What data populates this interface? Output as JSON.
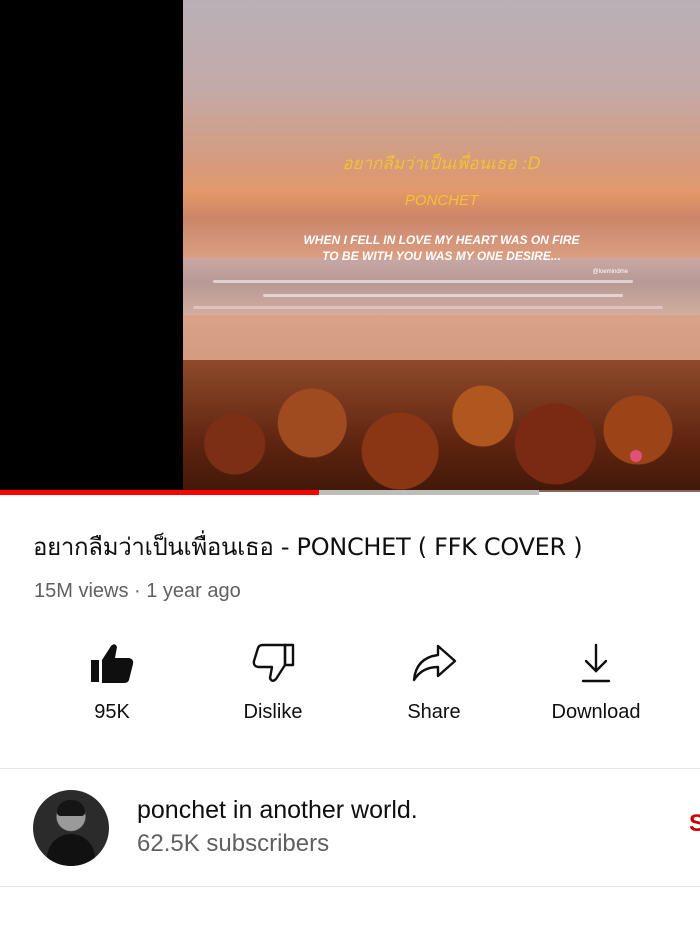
{
  "player": {
    "overlay_title": "อยากลืมว่าเป็นเพื่อนเธอ :D",
    "overlay_artist": "PONCHET",
    "overlay_lyrics_line1": "WHEN I FELL IN LOVE MY HEART WAS ON FIRE",
    "overlay_lyrics_line2": "TO BE WITH YOU WAS MY ONE DESIRE...",
    "overlay_credit": "@loemindme",
    "progress_fraction": 0.455,
    "buffered_fraction": 0.77,
    "progress_color": "#ff0000"
  },
  "video": {
    "title": "อยากลืมว่าเป็นเพื่อนเธอ - PONCHET ( FFK COVER )",
    "meta": "15M views · 1 year ago"
  },
  "actions": [
    {
      "icon": "thumbs-up-filled-icon",
      "label": "95K"
    },
    {
      "icon": "thumbs-down-icon",
      "label": "Dislike"
    },
    {
      "icon": "share-icon",
      "label": "Share"
    },
    {
      "icon": "download-icon",
      "label": "Download"
    }
  ],
  "channel": {
    "name": "ponchet in another world.",
    "subscribers": "62.5K subscribers",
    "subscribe_label": "S",
    "subscribe_color": "#cc0000"
  }
}
